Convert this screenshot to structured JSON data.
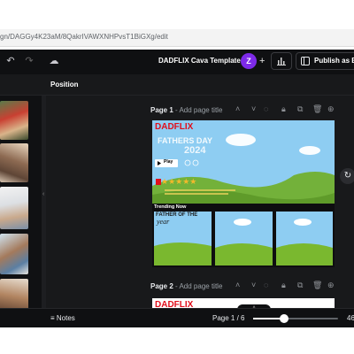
{
  "browser": {
    "url": "gn/DAGGy4K23aM/8QakrIVAWXNHPvsT1BiGXg/edit"
  },
  "toolbar": {
    "design_title": "DADFLIX Cava Template",
    "avatar_letter": "Z",
    "plus": "+",
    "publish_label": "Publish as Bra"
  },
  "subbar": {
    "position_label": "Position"
  },
  "pages": [
    {
      "label": "Page 1",
      "title_placeholder": "Add page title"
    },
    {
      "label": "Page 2",
      "title_placeholder": "Add page title"
    }
  ],
  "canvas": {
    "brand": "DADFLIX",
    "hero_title": "FATHERS DAY",
    "hero_year": "2024",
    "play_label": "Play",
    "trending_label": "Trending Now",
    "tile_title": "FATHER OF THE",
    "tile_subtitle": "year",
    "rating_star": "★",
    "rating_count": 5
  },
  "footer": {
    "notes_label": "Notes",
    "page_count": "Page 1 / 6",
    "zoom_value": "46",
    "zoom_fraction": 0.36
  },
  "colors": {
    "accent": "#7d2ae8",
    "brand_red": "#e10f1c",
    "sky": "#8ecdf2",
    "grass": "#7ab82f"
  }
}
